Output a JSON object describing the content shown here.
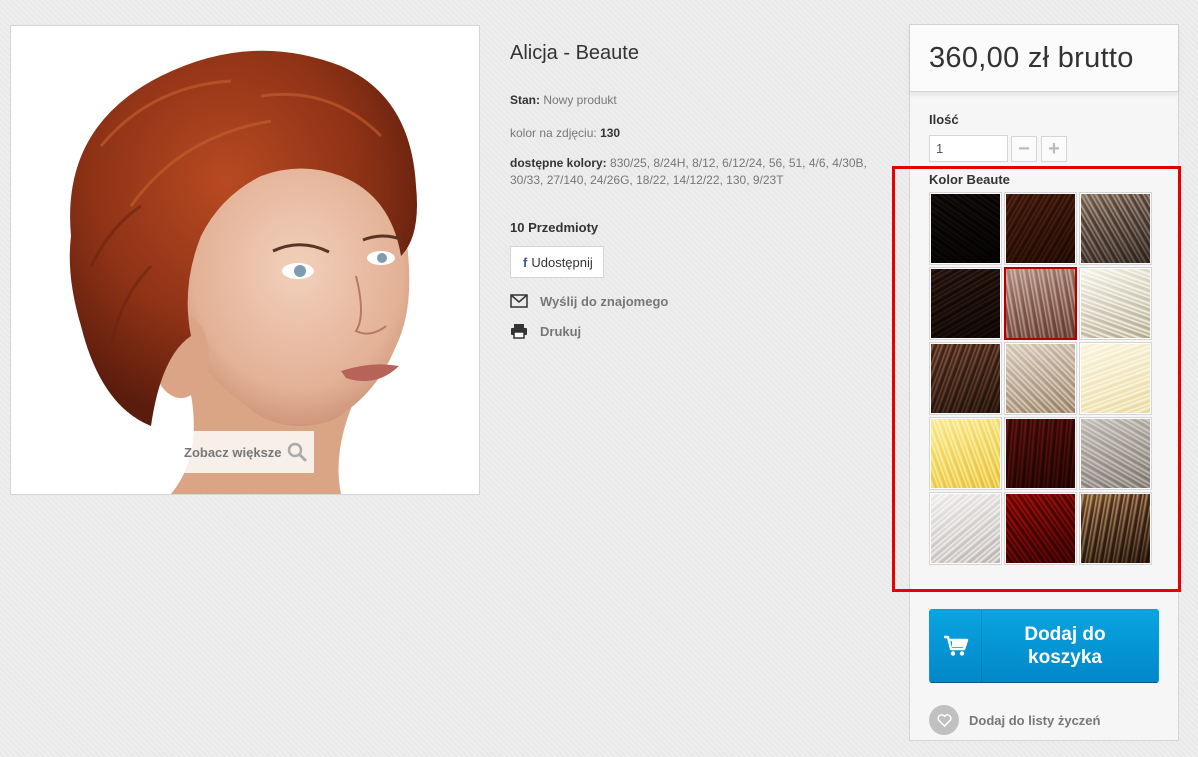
{
  "product": {
    "image_alt": "Alicja - Beaute",
    "zoom_label": "Zobacz większe",
    "title": "Alicja - Beaute",
    "condition_label": "Stan:",
    "condition_value": "Nowy produkt",
    "photo_color_label": "kolor na zdjęciu:",
    "photo_color_value": "130",
    "available_colors_label": "dostępne kolory:",
    "available_colors_value": "830/25, 8/24H, 8/12, 6/12/24, 56, 51, 4/6, 4/30B, 30/33, 27/140, 24/26G, 18/22, 14/12/22, 130, 9/23T",
    "quantity_in_stock": "10 Przedmioty",
    "share_label": "Udostępnij",
    "share_icon_glyph": "f",
    "send_friend_label": "Wyślij do znajomego",
    "print_label": "Drukuj"
  },
  "buy_box": {
    "price": "360,00 zł brutto",
    "quantity_label": "Ilość",
    "quantity_value": "1",
    "minus_label": "−",
    "plus_label": "+",
    "color_group_label": "Kolor Beaute",
    "add_to_cart_label": "Dodaj do koszyka",
    "wishlist_label": "Dodaj do listy życzeń"
  },
  "swatches": [
    {
      "name": "color-1",
      "base": "#120e0c",
      "light": "#3a3330",
      "selected": false
    },
    {
      "name": "color-2",
      "base": "#3a2216",
      "light": "#6f4a35",
      "selected": false
    },
    {
      "name": "color-3",
      "base": "#4a403a",
      "light": "#a09891",
      "selected": false
    },
    {
      "name": "color-4",
      "base": "#241814",
      "light": "#5a463c",
      "selected": false
    },
    {
      "name": "color-5",
      "base": "#6b554d",
      "light": "#b7a7a2",
      "selected": true
    },
    {
      "name": "color-6",
      "base": "#9a9484",
      "light": "#efeee3",
      "selected": false
    },
    {
      "name": "color-7",
      "base": "#3d2c22",
      "light": "#8a7060",
      "selected": false
    },
    {
      "name": "color-8",
      "base": "#8a7d70",
      "light": "#d0c7bd",
      "selected": false
    },
    {
      "name": "color-9",
      "base": "#c9b790",
      "light": "#f2ead4",
      "selected": false
    },
    {
      "name": "color-10",
      "base": "#c6a25a",
      "light": "#f1dfa5",
      "selected": false
    },
    {
      "name": "color-11",
      "base": "#3a1412",
      "light": "#7a3a34",
      "selected": false
    },
    {
      "name": "color-12",
      "base": "#7c7874",
      "light": "#bfbcb8",
      "selected": false
    },
    {
      "name": "color-13",
      "base": "#a09c9a",
      "light": "#e6e4e3",
      "selected": false
    },
    {
      "name": "color-14",
      "base": "#4a0e0a",
      "light": "#9a3526",
      "selected": false
    },
    {
      "name": "color-15",
      "base": "#3a2a1e",
      "light": "#a99882",
      "selected": false
    }
  ],
  "colors": {
    "highlight": "#e60000",
    "selected_border": "#b20000",
    "cart_button": "#0187c9"
  }
}
